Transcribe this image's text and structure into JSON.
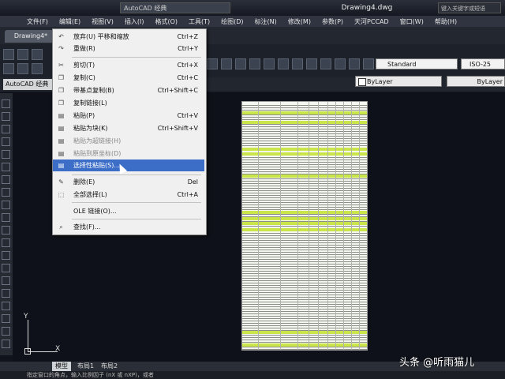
{
  "window": {
    "workspace": "AutoCAD 经典",
    "title": "Drawing4.dwg",
    "search": "键入关键字或短语"
  },
  "menubar": [
    "文件(F)",
    "编辑(E)",
    "视图(V)",
    "插入(I)",
    "格式(O)",
    "工具(T)",
    "绘图(D)",
    "标注(N)",
    "修改(M)",
    "参数(P)",
    "天河PCCAD",
    "窗口(W)",
    "帮助(H)"
  ],
  "tab": {
    "label": "Drawing4*"
  },
  "toolbar": {
    "workspace_label": "AutoCAD 经典",
    "text_style": "Standard",
    "dim_style": "ISO-25",
    "layer": "ByLayer",
    "linetype": "ByLayer"
  },
  "edit_menu": {
    "items": [
      {
        "label": "放弃(U) 平移和缩放",
        "shortcut": "Ctrl+Z",
        "icon": "undo-icon",
        "glyph": "↶",
        "disabled": false
      },
      {
        "label": "重做(R)",
        "shortcut": "Ctrl+Y",
        "icon": "redo-icon",
        "glyph": "↷",
        "disabled": false
      },
      {
        "label": "剪切(T)",
        "shortcut": "Ctrl+X",
        "icon": "cut-icon",
        "glyph": "✂",
        "disabled": false
      },
      {
        "label": "复制(C)",
        "shortcut": "Ctrl+C",
        "icon": "copy-icon",
        "glyph": "❐",
        "disabled": false
      },
      {
        "label": "带基点复制(B)",
        "shortcut": "Ctrl+Shift+C",
        "icon": "copy-base-icon",
        "glyph": "❐",
        "disabled": false
      },
      {
        "label": "复制链接(L)",
        "shortcut": "",
        "icon": "copy-link-icon",
        "glyph": "❐",
        "disabled": false
      },
      {
        "label": "粘贴(P)",
        "shortcut": "Ctrl+V",
        "icon": "paste-icon",
        "glyph": "▤",
        "disabled": false
      },
      {
        "label": "粘贴为块(K)",
        "shortcut": "Ctrl+Shift+V",
        "icon": "paste-block-icon",
        "glyph": "▤",
        "disabled": false
      },
      {
        "label": "粘贴为超链接(H)",
        "shortcut": "",
        "icon": "paste-hyperlink-icon",
        "glyph": "▤",
        "disabled": true
      },
      {
        "label": "粘贴到原坐标(D)",
        "shortcut": "",
        "icon": "paste-orig-icon",
        "glyph": "▤",
        "disabled": true
      },
      {
        "label": "选择性粘贴(S)...",
        "shortcut": "",
        "icon": "paste-special-icon",
        "glyph": "▤",
        "disabled": false,
        "selected": true
      },
      {
        "label": "删除(E)",
        "shortcut": "Del",
        "icon": "erase-icon",
        "glyph": "✎",
        "disabled": false
      },
      {
        "label": "全部选择(L)",
        "shortcut": "Ctrl+A",
        "icon": "select-all-icon",
        "glyph": "⬚",
        "disabled": false
      },
      {
        "label": "OLE 链接(O)...",
        "shortcut": "",
        "icon": "",
        "glyph": "",
        "disabled": false
      },
      {
        "label": "查找(F)...",
        "shortcut": "",
        "icon": "find-icon",
        "glyph": "⌕",
        "disabled": false
      }
    ]
  },
  "layout_tabs": [
    "模型",
    "布局1",
    "布局2"
  ],
  "command_line": "指定窗口的角点，输入比例因子 (nX 或 nXP)，或者",
  "ucs": {
    "x": "X",
    "y": "Y"
  },
  "watermark": "头条 @听雨猫儿",
  "colors": {
    "selected": "#3c6ec8",
    "highlight_row": "#c8e64a",
    "sheet": "#f4f6f0"
  }
}
